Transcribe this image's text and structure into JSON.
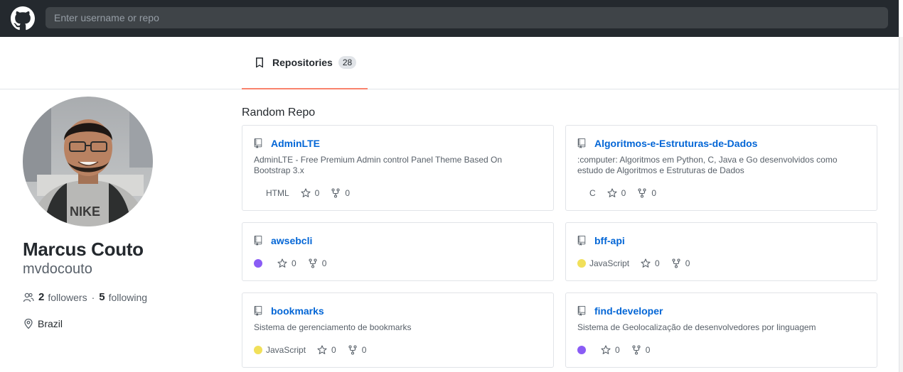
{
  "header": {
    "search_placeholder": "Enter username or repo"
  },
  "tabs": [
    {
      "label": "Repositories",
      "count": "28"
    }
  ],
  "profile": {
    "full_name": "Marcus Couto",
    "username": "mvdocouto",
    "followers_count": "2",
    "followers_label": "followers",
    "separator": "·",
    "following_count": "5",
    "following_label": "following",
    "location": "Brazil"
  },
  "section_title": "Random Repo",
  "colors": {
    "accent_tab": "#f9826c",
    "link": "#0366d6",
    "javascript": "#f1e05a",
    "purple_lang": "#8a5cf5"
  },
  "repos": [
    {
      "name": "AdminLTE",
      "description": "AdminLTE - Free Premium Admin control Panel Theme Based On Bootstrap 3.x",
      "language": "HTML",
      "lang_color": "",
      "stars": "0",
      "forks": "0"
    },
    {
      "name": "Algoritmos-e-Estruturas-de-Dados",
      "description": ":computer: Algoritmos em Python, C, Java e Go desenvolvidos como estudo de Algoritmos e Estruturas de Dados",
      "language": "C",
      "lang_color": "",
      "stars": "0",
      "forks": "0"
    },
    {
      "name": "awsebcli",
      "description": "",
      "language": "",
      "lang_color": "#8a5cf5",
      "stars": "0",
      "forks": "0"
    },
    {
      "name": "bff-api",
      "description": "",
      "language": "JavaScript",
      "lang_color": "#f1e05a",
      "stars": "0",
      "forks": "0"
    },
    {
      "name": "bookmarks",
      "description": "Sistema de gerenciamento de bookmarks",
      "language": "JavaScript",
      "lang_color": "#f1e05a",
      "stars": "0",
      "forks": "0"
    },
    {
      "name": "find-developer",
      "description": "Sistema de Geolocalização de desenvolvedores por linguagem",
      "language": "",
      "lang_color": "#8a5cf5",
      "stars": "0",
      "forks": "0"
    }
  ]
}
